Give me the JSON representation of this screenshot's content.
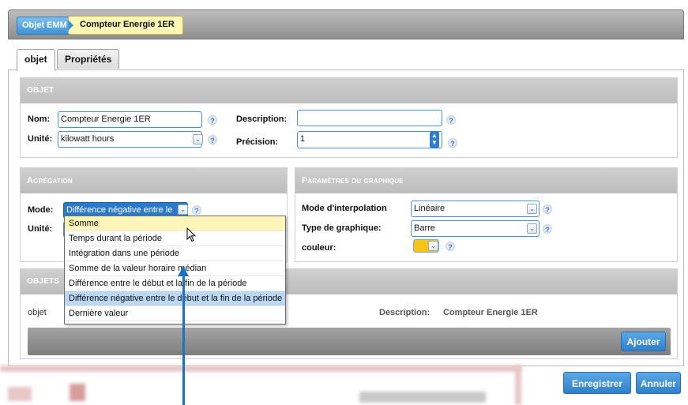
{
  "breadcrumb": {
    "root": "Objet EMM",
    "current": "Compteur Energie 1ER"
  },
  "tabs": [
    "objet",
    "Propriétés"
  ],
  "objet": {
    "header": "OBJET",
    "nom_label": "Nom:",
    "nom_value": "Compteur Energie 1ER",
    "unite_label": "Unité:",
    "unite_value": "kilowatt hours",
    "description_label": "Description:",
    "description_value": "",
    "precision_label": "Précision:",
    "precision_value": "1"
  },
  "agregation": {
    "header": "Agrégation",
    "mode_label": "Mode:",
    "mode_value": "Différence négative entre le",
    "unite_label": "Unité:"
  },
  "graphique": {
    "header": "Paramètres du graphique",
    "interp_label": "Mode d'interpolation",
    "interp_value": "Linéaire",
    "type_label": "Type de graphique:",
    "type_value": "Barre",
    "couleur_label": "couleur:",
    "couleur_hex": "#f5c518"
  },
  "dropdown_options": [
    "Somme",
    "Temps durant la période",
    "Intégration dans une période",
    "Somme de la valeur horaire médian",
    "Différence entre le début et la fin de la période",
    "Différence négative entre le début et la fin de la période",
    "Dernière valeur"
  ],
  "dropdown_selected_index": 5,
  "objets": {
    "header": "OBJETS",
    "objet_label": "objet",
    "description_label": "Description:",
    "description_value": "Compteur Energie 1ER",
    "ajouter_label": "Ajouter"
  },
  "footer": {
    "save_label": "Enregistrer",
    "cancel_label": "Annuler"
  },
  "help_glyph": "?",
  "icons": {
    "select_arrow": "chevron-down-icon",
    "help": "help-icon",
    "spinner": "spinner-icon",
    "cursor": "mouse-cursor-icon",
    "arrow": "annotation-arrow-icon"
  },
  "colors": {
    "accent_blue": "#2f7fcc",
    "breadcrumb_current_bg": "#fff7b3",
    "selected_option_bg": "#bcd7f2"
  }
}
